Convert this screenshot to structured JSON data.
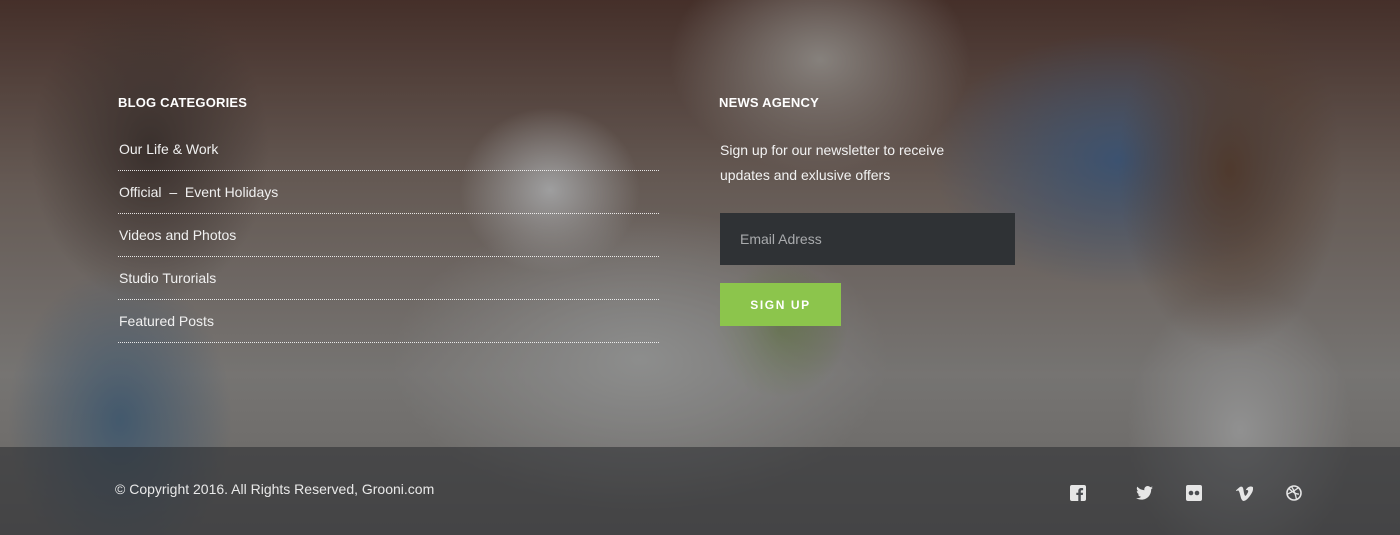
{
  "blog": {
    "title": "BLOG CATEGORIES",
    "items": [
      "Our Life & Work",
      "Official  –  Event Holidays",
      "Videos and Photos",
      "Studio Turorials",
      "Featured Posts"
    ]
  },
  "news": {
    "title": "NEWS AGENCY",
    "text": "Sign up for our newsletter to receive updates and exlusive offers",
    "email_placeholder": "Email Adress",
    "button_label": "SIGN UP"
  },
  "footer": {
    "copyright": "© Copyright 2016. All Rights Reserved, Grooni.com",
    "social_icons": [
      "facebook-icon",
      "twitter-icon",
      "flickr-icon",
      "vimeo-icon",
      "dribbble-icon"
    ]
  },
  "colors": {
    "accent": "#8cc54c",
    "input_bg": "#2f3235"
  }
}
